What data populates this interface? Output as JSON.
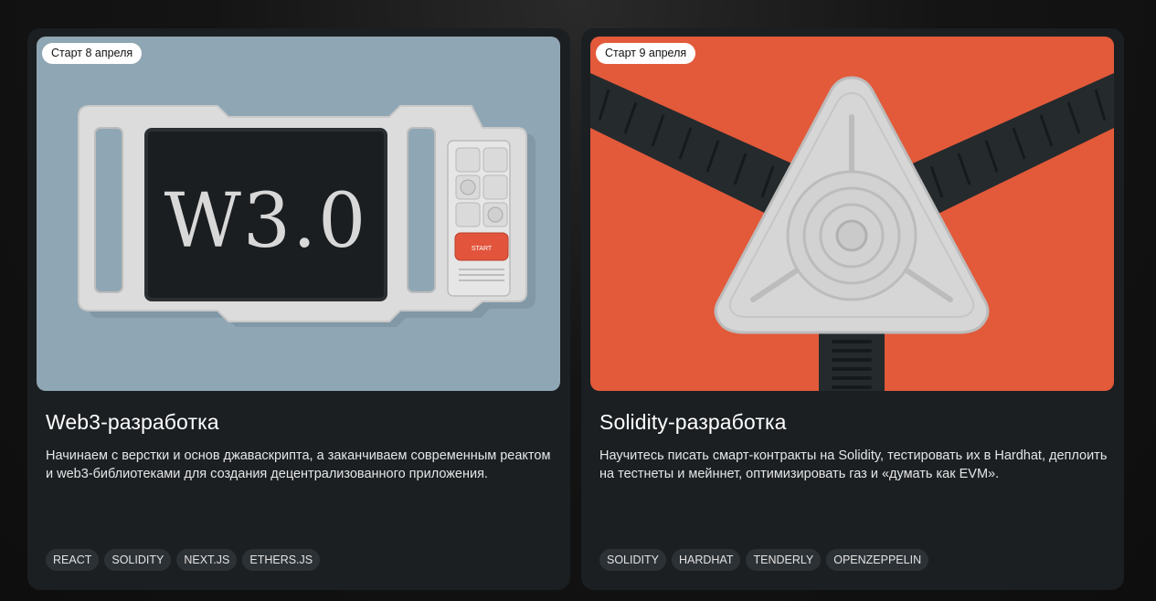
{
  "cards": [
    {
      "start_label": "Старт 8 апреля",
      "title": "Web3-разработка",
      "description": "Начинаем с верстки и основ джаваскрипта, а заканчиваем современным реактом и web3-библиотеками для создания децентрализованного приложения.",
      "tags": [
        "REACT",
        "SOLIDITY",
        "NEXT.JS",
        "ETHERS.JS"
      ],
      "image": {
        "screen_text": "W3.0",
        "button_text": "START",
        "background_color": "#8fa6b4",
        "accent_color": "#e2553c"
      }
    },
    {
      "start_label": "Старт 9 апреля",
      "title": "Solidity-разработка",
      "description": "Научитесь писать смарт-контракты на Solidity, тестировать их в Hardhat, деплоить на тестнеты и мейннет, оптимизировать газ и «думать как EVM».",
      "tags": [
        "SOLIDITY",
        "HARDHAT",
        "TENDERLY",
        "OPENZEPPELIN"
      ],
      "image": {
        "background_color": "#e25a3a",
        "strap_color": "#252a2d"
      }
    }
  ]
}
